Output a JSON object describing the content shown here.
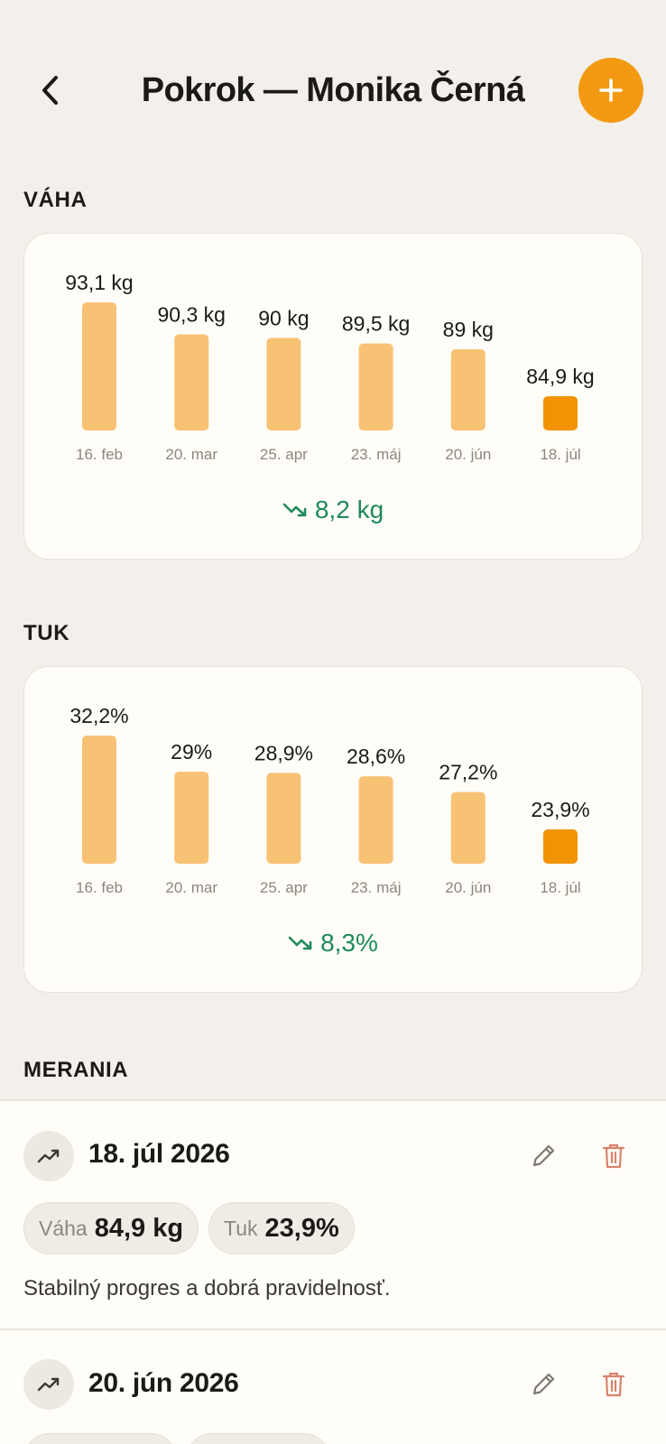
{
  "header": {
    "title": "Pokrok — Monika Černá",
    "back_icon": "chevron-left-icon",
    "add_icon": "plus-icon",
    "accent_color": "#f39a12"
  },
  "sections": {
    "weight_label": "VÁHA",
    "fat_label": "TUK",
    "measurements_label": "MERANIA"
  },
  "chart_data": [
    {
      "type": "bar",
      "categories": [
        "16. feb",
        "20. mar",
        "25. apr",
        "23. máj",
        "20. jún",
        "18. júl"
      ],
      "values": [
        93.1,
        90.3,
        90,
        89.5,
        89,
        84.9
      ],
      "value_labels": [
        "93,1 kg",
        "90,3 kg",
        "90 kg",
        "89,5 kg",
        "89 kg",
        "84,9 kg"
      ],
      "highlight_index": 5,
      "bar_color": "#f8c275",
      "highlight_color": "#f29305",
      "delta": "8,2 kg",
      "delta_icon": "trending-down-icon",
      "delta_color": "#1f8a5c"
    },
    {
      "type": "bar",
      "categories": [
        "16. feb",
        "20. mar",
        "25. apr",
        "23. máj",
        "20. jún",
        "18. júl"
      ],
      "values": [
        32.2,
        29,
        28.9,
        28.6,
        27.2,
        23.9
      ],
      "value_labels": [
        "32,2%",
        "29%",
        "28,9%",
        "28,6%",
        "27,2%",
        "23,9%"
      ],
      "highlight_index": 5,
      "bar_color": "#f8c275",
      "highlight_color": "#f29305",
      "delta": "8,3%",
      "delta_icon": "trending-down-icon",
      "delta_color": "#1f8a5c"
    }
  ],
  "measurements": [
    {
      "date": "18. júl 2026",
      "weight_label": "Váha",
      "weight_value": "84,9 kg",
      "fat_label": "Tuk",
      "fat_value": "23,9%",
      "note": "Stabilný progres a dobrá pravidelnosť.",
      "icon": "trending-up-icon"
    },
    {
      "date": "20. jún 2026",
      "icon": "trending-up-icon"
    }
  ]
}
